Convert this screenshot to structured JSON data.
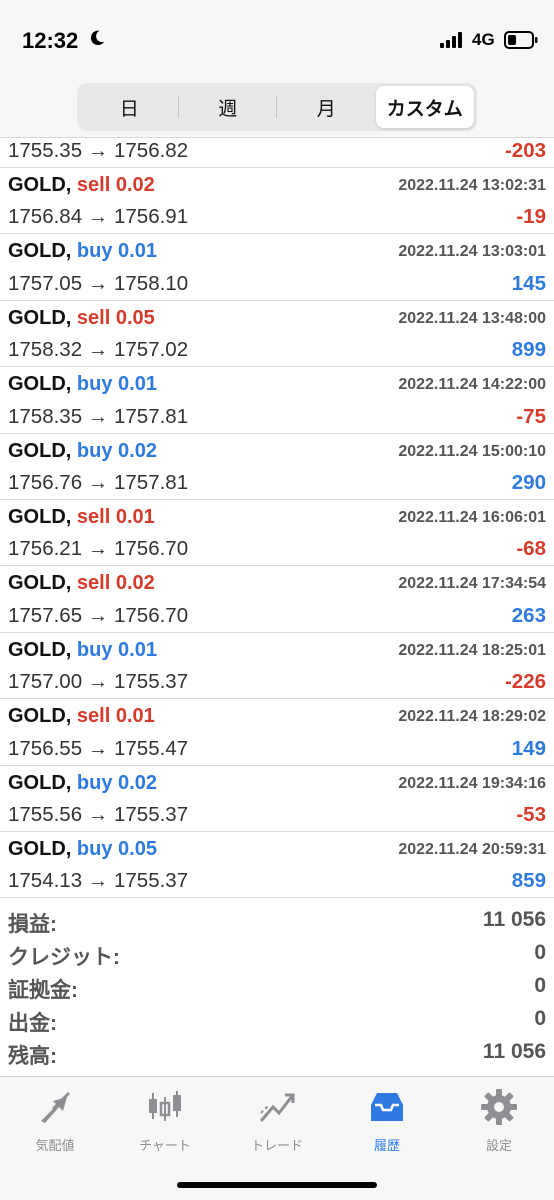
{
  "status": {
    "time": "12:32",
    "network": "4G"
  },
  "period_tabs": [
    {
      "label": "日",
      "active": false
    },
    {
      "label": "週",
      "active": false
    },
    {
      "label": "月",
      "active": false
    },
    {
      "label": "カスタム",
      "active": true
    }
  ],
  "first_row": {
    "prices": "1755.35 → 1756.82",
    "profit": "-203"
  },
  "trades": [
    {
      "symbol": "GOLD,",
      "side": "sell 0.02",
      "date": "2022.11.24 13:02:31",
      "prices": "1756.84 → 1756.91",
      "profit": "-19"
    },
    {
      "symbol": "GOLD,",
      "side": "buy 0.01",
      "date": "2022.11.24 13:03:01",
      "prices": "1757.05 → 1758.10",
      "profit": "145"
    },
    {
      "symbol": "GOLD,",
      "side": "sell 0.05",
      "date": "2022.11.24 13:48:00",
      "prices": "1758.32 → 1757.02",
      "profit": "899"
    },
    {
      "symbol": "GOLD,",
      "side": "buy 0.01",
      "date": "2022.11.24 14:22:00",
      "prices": "1758.35 → 1757.81",
      "profit": "-75"
    },
    {
      "symbol": "GOLD,",
      "side": "buy 0.02",
      "date": "2022.11.24 15:00:10",
      "prices": "1756.76 → 1757.81",
      "profit": "290"
    },
    {
      "symbol": "GOLD,",
      "side": "sell 0.01",
      "date": "2022.11.24 16:06:01",
      "prices": "1756.21 → 1756.70",
      "profit": "-68"
    },
    {
      "symbol": "GOLD,",
      "side": "sell 0.02",
      "date": "2022.11.24 17:34:54",
      "prices": "1757.65 → 1756.70",
      "profit": "263"
    },
    {
      "symbol": "GOLD,",
      "side": "buy 0.01",
      "date": "2022.11.24 18:25:01",
      "prices": "1757.00 → 1755.37",
      "profit": "-226"
    },
    {
      "symbol": "GOLD,",
      "side": "sell 0.01",
      "date": "2022.11.24 18:29:02",
      "prices": "1756.55 → 1755.47",
      "profit": "149"
    },
    {
      "symbol": "GOLD,",
      "side": "buy 0.02",
      "date": "2022.11.24 19:34:16",
      "prices": "1755.56 → 1755.37",
      "profit": "-53"
    },
    {
      "symbol": "GOLD,",
      "side": "buy 0.05",
      "date": "2022.11.24 20:59:31",
      "prices": "1754.13 → 1755.37",
      "profit": "859"
    }
  ],
  "summary": [
    {
      "label": "損益:",
      "value": "11 056"
    },
    {
      "label": "クレジット:",
      "value": "0"
    },
    {
      "label": "証拠金:",
      "value": "0"
    },
    {
      "label": "出金:",
      "value": "0"
    },
    {
      "label": "残高:",
      "value": "11 056"
    }
  ],
  "tabbar": [
    {
      "label": "気配値",
      "icon": "quotes-arrows-icon",
      "active": false
    },
    {
      "label": "チャート",
      "icon": "candlestick-chart-icon",
      "active": false
    },
    {
      "label": "トレード",
      "icon": "trade-line-icon",
      "active": false
    },
    {
      "label": "履歴",
      "icon": "history-tray-icon",
      "active": true
    },
    {
      "label": "設定",
      "icon": "gear-icon",
      "active": false
    }
  ],
  "colors": {
    "sell": "#d63b2c",
    "buy": "#2f7ae0",
    "loss": "#d63b2c",
    "gain": "#2f7ae0",
    "active_tab": "#2f7ae0",
    "inactive_tab": "#8e8e93"
  }
}
